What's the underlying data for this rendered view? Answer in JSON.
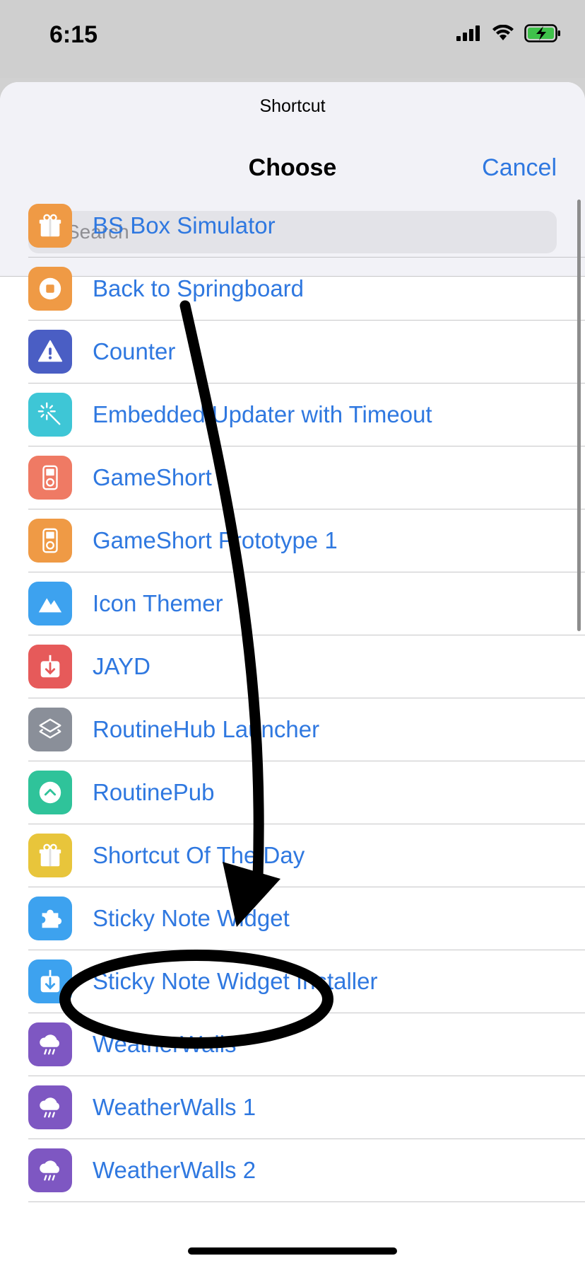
{
  "status_bar": {
    "time": "6:15"
  },
  "sheet": {
    "subtitle": "Shortcut",
    "title": "Choose",
    "cancel_label": "Cancel",
    "search_placeholder": "Search"
  },
  "items": [
    {
      "label": "BS Box Simulator",
      "color": "#ef9a45",
      "icon": "gift-icon"
    },
    {
      "label": "Back to Springboard",
      "color": "#ef9a45",
      "icon": "stop-icon"
    },
    {
      "label": "Counter",
      "color": "#4a5ec4",
      "icon": "warning-icon"
    },
    {
      "label": "Embedded Updater with Timeout",
      "color": "#3ec6d6",
      "icon": "magic-wand-icon"
    },
    {
      "label": "GameShort",
      "color": "#ef7a64",
      "icon": "ipod-icon"
    },
    {
      "label": "GameShort Prototype 1",
      "color": "#ef9a45",
      "icon": "ipod-icon"
    },
    {
      "label": "Icon Themer",
      "color": "#3da2ef",
      "icon": "mountain-icon"
    },
    {
      "label": "JAYD",
      "color": "#e65a5a",
      "icon": "download-icon"
    },
    {
      "label": "RoutineHub Launcher",
      "color": "#8a8f99",
      "icon": "layers-icon"
    },
    {
      "label": "RoutinePub",
      "color": "#2fc39a",
      "icon": "chevron-up-circle-icon"
    },
    {
      "label": "Shortcut Of The Day",
      "color": "#e8c53b",
      "icon": "gift-icon"
    },
    {
      "label": "Sticky Note Widget",
      "color": "#3da2ef",
      "icon": "puzzle-icon"
    },
    {
      "label": "Sticky Note Widget Installer",
      "color": "#3da2ef",
      "icon": "download-icon"
    },
    {
      "label": "WeatherWalls",
      "color": "#7e57c2",
      "icon": "rain-cloud-icon"
    },
    {
      "label": "WeatherWalls 1",
      "color": "#7e57c2",
      "icon": "rain-cloud-icon"
    },
    {
      "label": "WeatherWalls 2",
      "color": "#7e57c2",
      "icon": "rain-cloud-icon"
    }
  ],
  "colors": {
    "accent": "#2f78e0",
    "annotation": "#000000"
  }
}
